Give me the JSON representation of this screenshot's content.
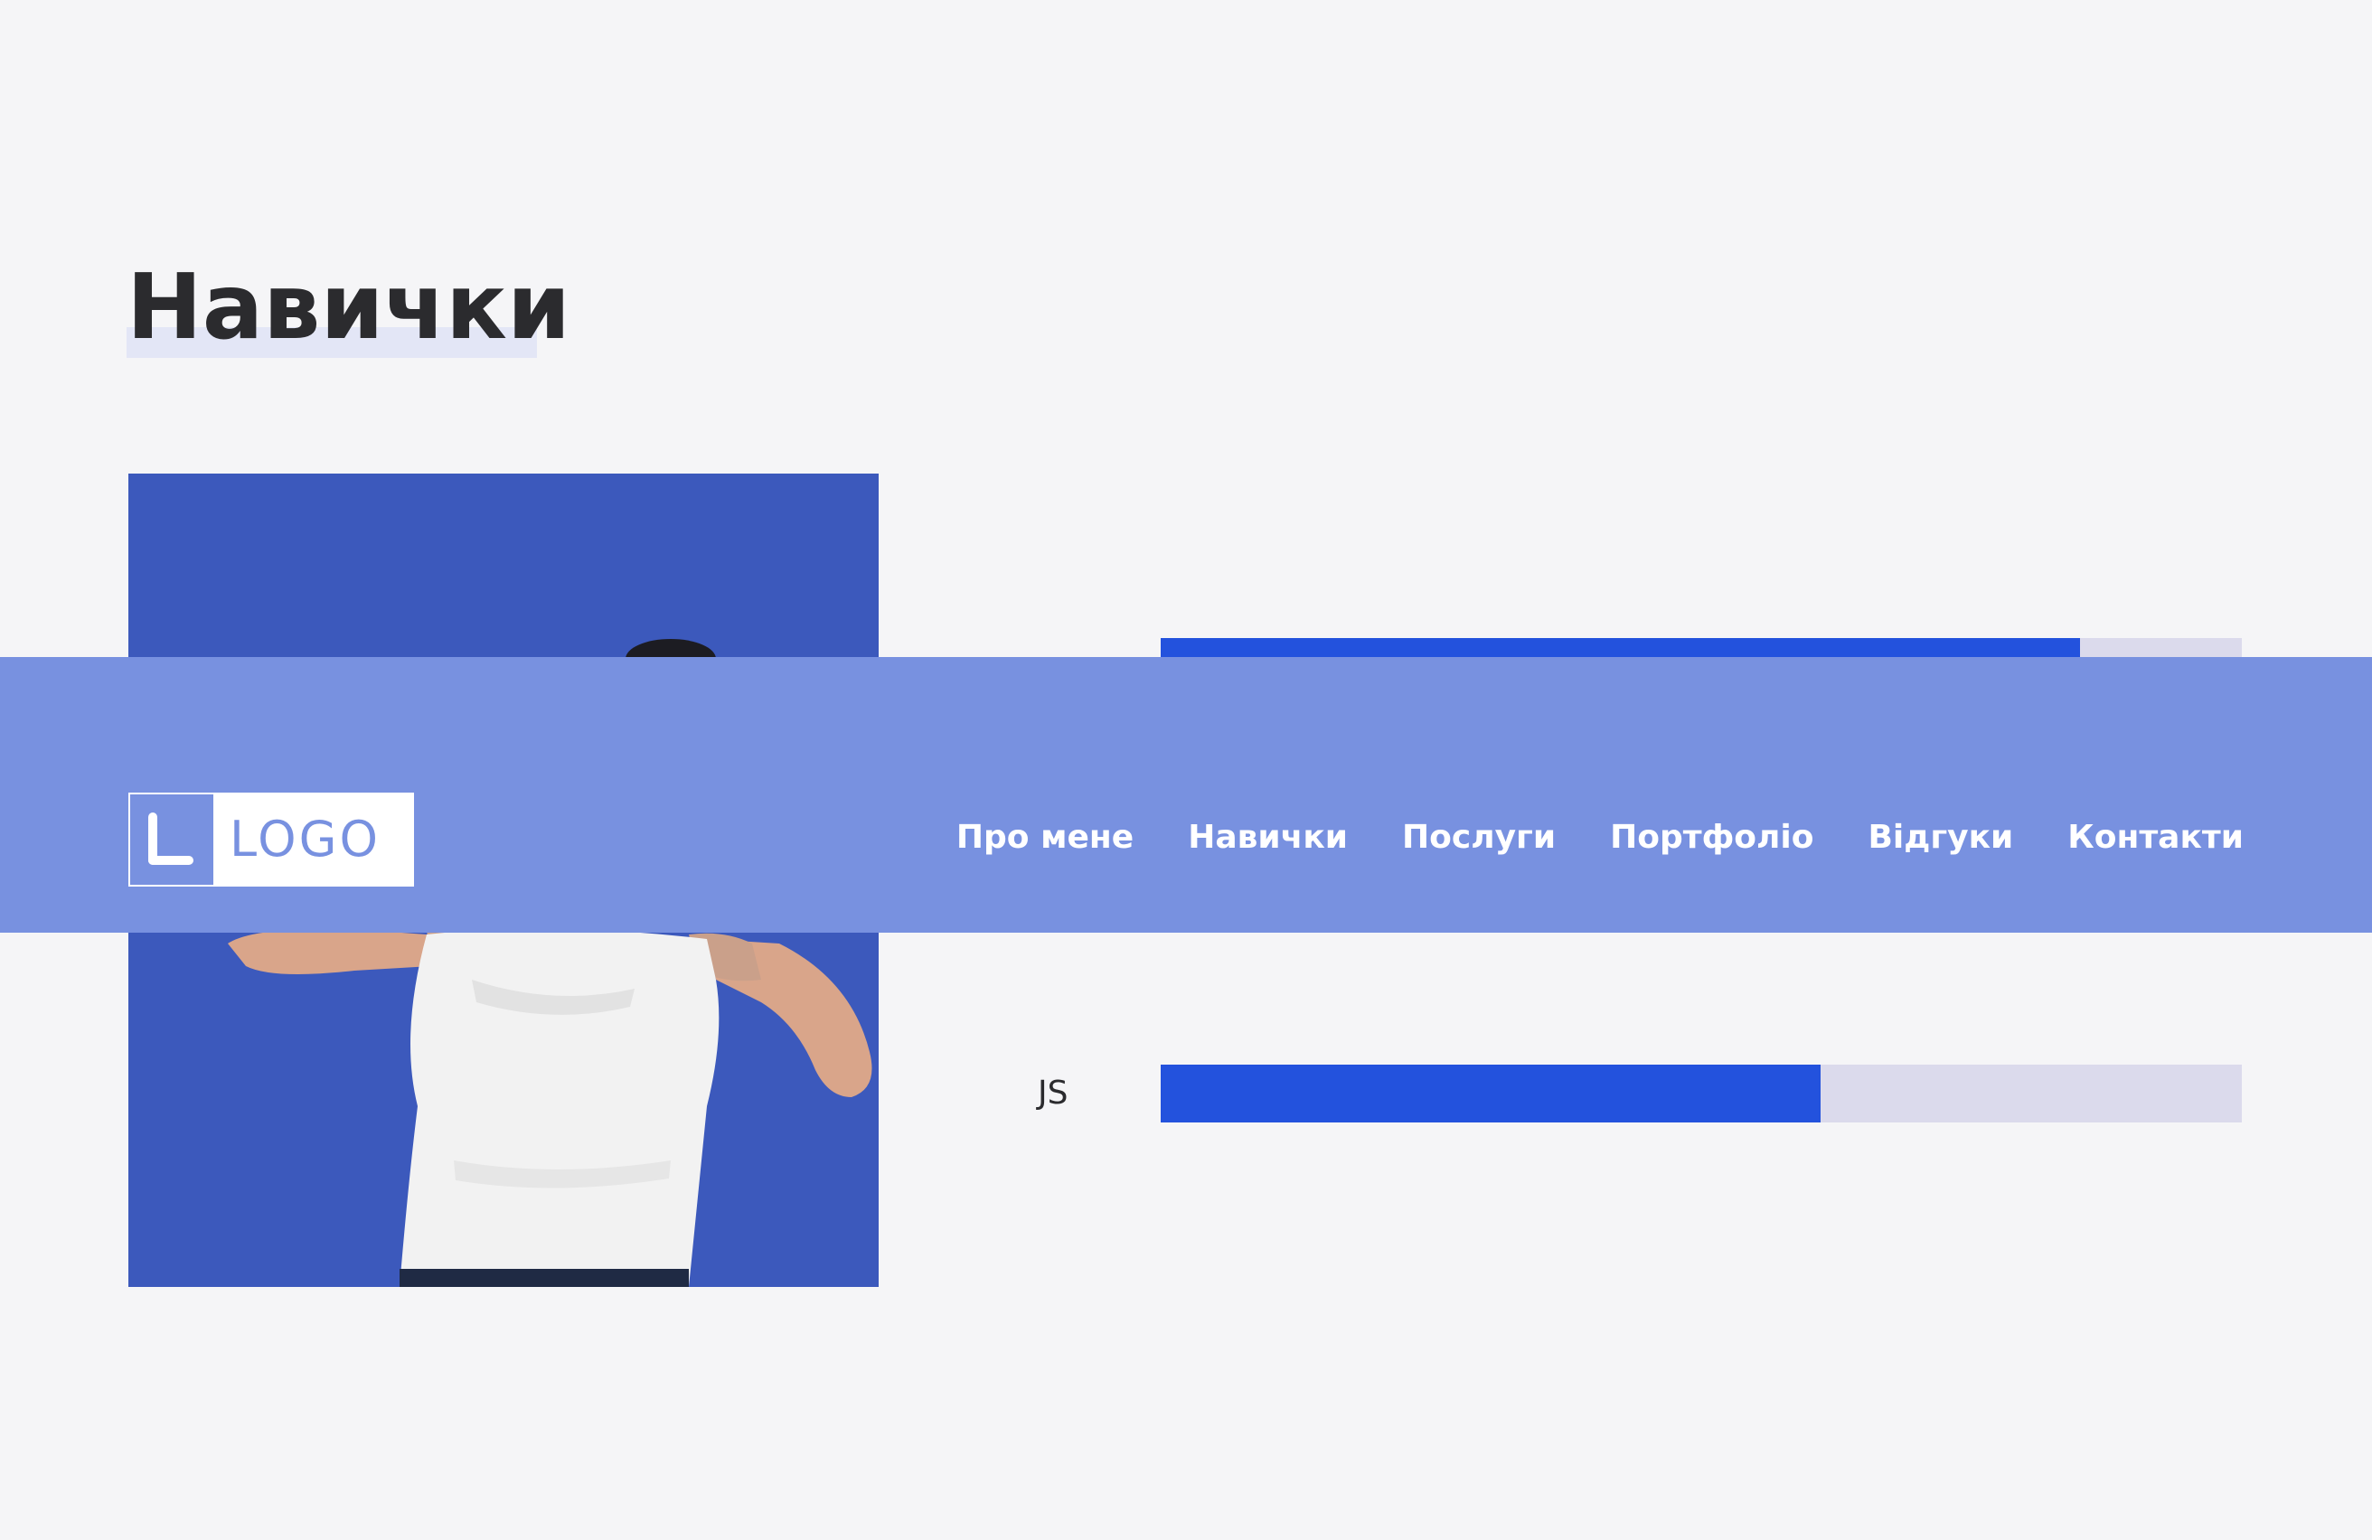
{
  "skills_section": {
    "title": "Навички",
    "skills": [
      {
        "label": "",
        "level": 0.85
      },
      {
        "label": "JS",
        "level": 0.61
      }
    ]
  },
  "header": {
    "logo_text": "LOGO",
    "nav": [
      {
        "label": "Про мене"
      },
      {
        "label": "Навички"
      },
      {
        "label": "Послуги"
      },
      {
        "label": "Портфоліо"
      },
      {
        "label": "Відгуки"
      },
      {
        "label": "Контакти"
      }
    ]
  },
  "colors": {
    "page_background": "#f5f5f7",
    "header_background": "#7891e0",
    "photo_background": "#3c59bc",
    "bar_fill": "#2352dd",
    "bar_track": "#dbdaec",
    "title_text": "#2b2b2e"
  },
  "icons": {
    "logo_mark": "logo-l-icon"
  }
}
